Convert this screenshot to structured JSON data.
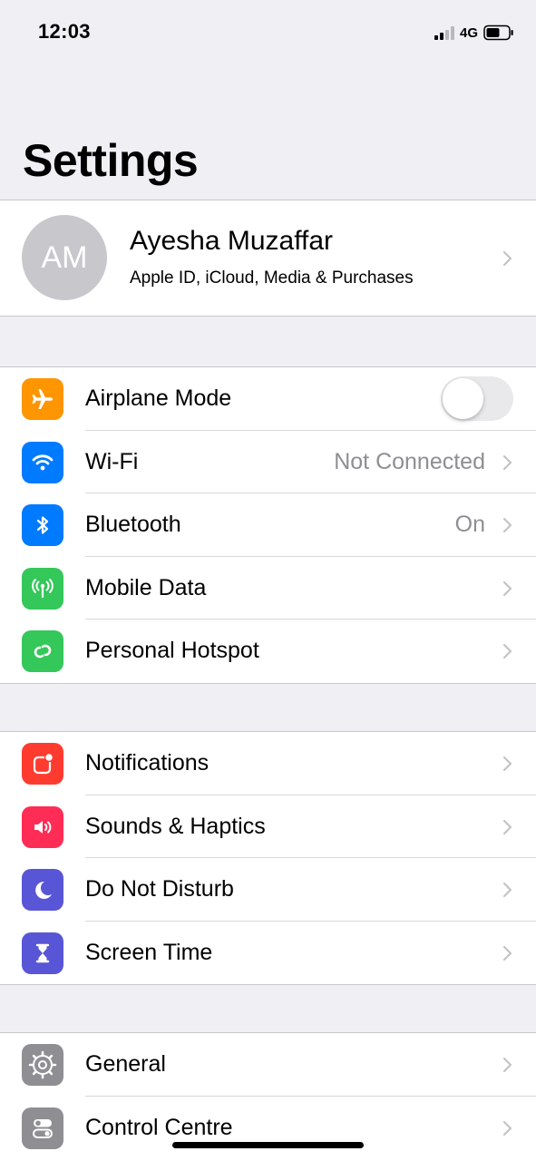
{
  "status_bar": {
    "time": "12:03",
    "network": "4G"
  },
  "page_title": "Settings",
  "profile": {
    "initials": "AM",
    "name": "Ayesha Muzaffar",
    "subtitle": "Apple ID, iCloud, Media & Purchases"
  },
  "connectivity": {
    "airplane": {
      "label": "Airplane Mode",
      "toggle_on": false,
      "icon": "airplane-icon",
      "color": "#ff9500"
    },
    "wifi": {
      "label": "Wi-Fi",
      "value": "Not Connected",
      "icon": "wifi-icon",
      "color": "#007aff"
    },
    "bluetooth": {
      "label": "Bluetooth",
      "value": "On",
      "icon": "bluetooth-icon",
      "color": "#007aff"
    },
    "mobile_data": {
      "label": "Mobile Data",
      "icon": "antenna-icon",
      "color": "#34c759"
    },
    "hotspot": {
      "label": "Personal Hotspot",
      "icon": "hotspot-icon",
      "color": "#34c759"
    }
  },
  "attention": {
    "notifications": {
      "label": "Notifications",
      "icon": "notifications-icon",
      "color": "#ff3b30"
    },
    "sounds": {
      "label": "Sounds & Haptics",
      "icon": "speaker-icon",
      "color": "#ff2d55"
    },
    "dnd": {
      "label": "Do Not Disturb",
      "icon": "moon-icon",
      "color": "#5856d6"
    },
    "screen_time": {
      "label": "Screen Time",
      "icon": "hourglass-icon",
      "color": "#5856d6"
    }
  },
  "system": {
    "general": {
      "label": "General",
      "icon": "gear-icon",
      "color": "#8e8e93"
    },
    "control_centre": {
      "label": "Control Centre",
      "icon": "switches-icon",
      "color": "#8e8e93"
    }
  }
}
